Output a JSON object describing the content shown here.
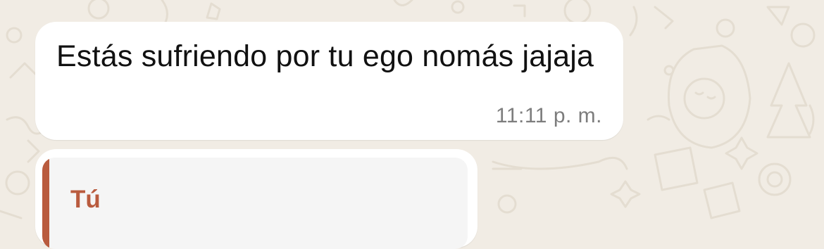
{
  "chat": {
    "message": {
      "text": "Estás sufriendo por tu ego nomás jajaja",
      "time": "11:11 p. m."
    },
    "reply_preview": {
      "author": "Tú"
    }
  },
  "colors": {
    "wallpaper": "#f1ece4",
    "bubble": "#ffffff",
    "quote_bg": "#f5f5f5",
    "quote_accent": "#b95b3e"
  }
}
